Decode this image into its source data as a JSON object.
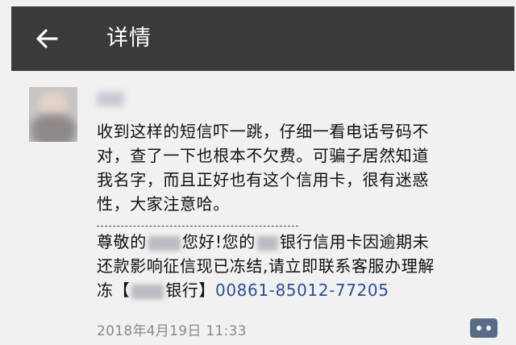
{
  "header": {
    "title": "详情",
    "back_icon": "arrow-left-icon"
  },
  "post": {
    "author_name_blurred": true,
    "text_lines": [
      "收到这样的短信吓一跳，仔细一看电话号码不",
      "对，查了一下也根本不欠费。可骗子居然知道",
      "我名字，而且正好也有这个信用卡，很有迷惑",
      "性，大家注意哈。"
    ],
    "divider": "-------------------------------------",
    "sms": {
      "l1_a": "尊敬的",
      "l1_b": "您好!您的",
      "l1_c": "银行信用卡因逾期未",
      "l2": "还款影响征信现已冻结,请立即联系客服办理解",
      "l3_a": "冻【",
      "l3_b": "银行】",
      "phone": "00861-85012-77205"
    },
    "timestamp": "2018年4月19日 11:33",
    "comment_icon": "comment-icon"
  },
  "colors": {
    "header_bg": "#3a3a3a",
    "page_bg": "#f1f1f1",
    "phone_link": "#2b4f9a",
    "comment_button": "#5a6b86"
  }
}
